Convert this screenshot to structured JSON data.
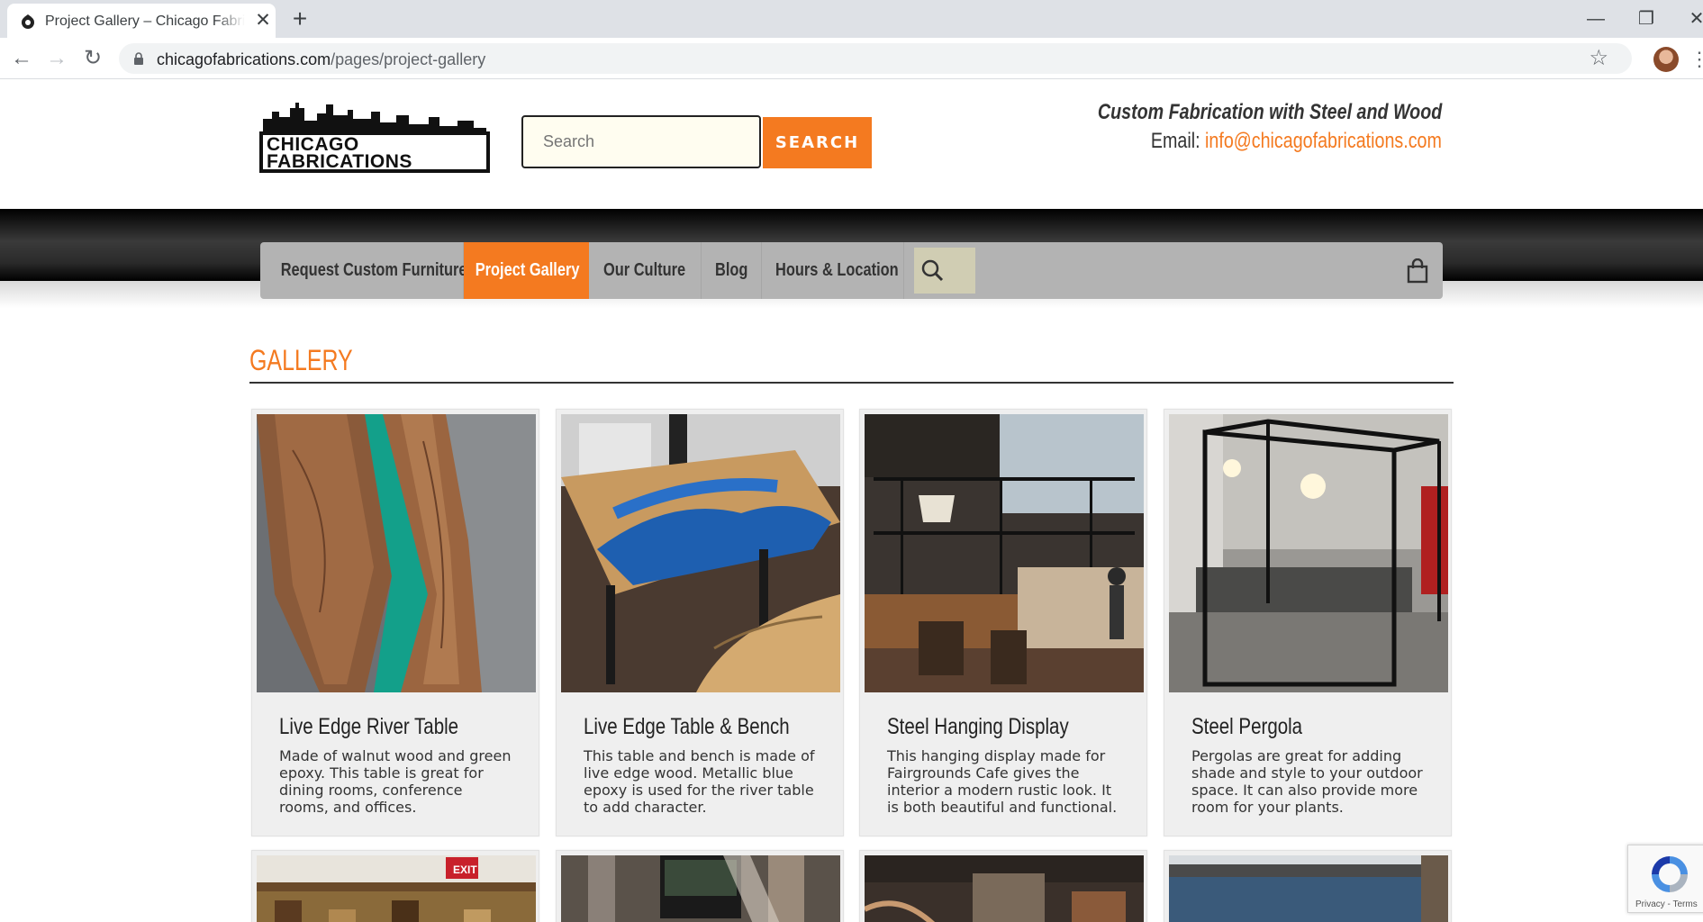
{
  "browser": {
    "tab_title": "Project Gallery – Chicago Fabrications",
    "url_host": "chicagofabrications.com",
    "url_path": "/pages/project-gallery",
    "new_tab": "+",
    "close": "✕"
  },
  "header": {
    "logo_line1": "CHICAGO",
    "logo_line2": "FABRICATIONS",
    "search_placeholder": "Search",
    "search_button": "SEARCH",
    "tagline": "Custom Fabrication with Steel and Wood",
    "email_label": "Email: ",
    "email": "info@chicagofabrications.com"
  },
  "nav": {
    "items": [
      {
        "label": "Request Custom Furniture"
      },
      {
        "label": "Project Gallery"
      },
      {
        "label": "Our Culture"
      },
      {
        "label": "Blog"
      },
      {
        "label": "Hours & Location"
      }
    ]
  },
  "gallery": {
    "title": "GALLERY",
    "cards": [
      {
        "title": "Live Edge River Table",
        "desc": "Made of walnut wood and green epoxy. This table is great for dining rooms, conference rooms, and offices."
      },
      {
        "title": "Live Edge Table & Bench",
        "desc": "This table and bench is made of live edge wood. Metallic blue epoxy is used for the river table to add character."
      },
      {
        "title": "Steel Hanging Display",
        "desc": "This hanging display made for Fairgrounds Cafe gives the interior a modern rustic look. It is both beautiful and functional."
      },
      {
        "title": "Steel Pergola",
        "desc": "Pergolas are great for adding shade and style to your outdoor space. It can also provide more room for your plants."
      }
    ]
  },
  "recaptcha": {
    "terms": "Privacy - Terms"
  },
  "colors": {
    "accent": "#f47a20",
    "nav_bg": "#b3b3b3"
  }
}
